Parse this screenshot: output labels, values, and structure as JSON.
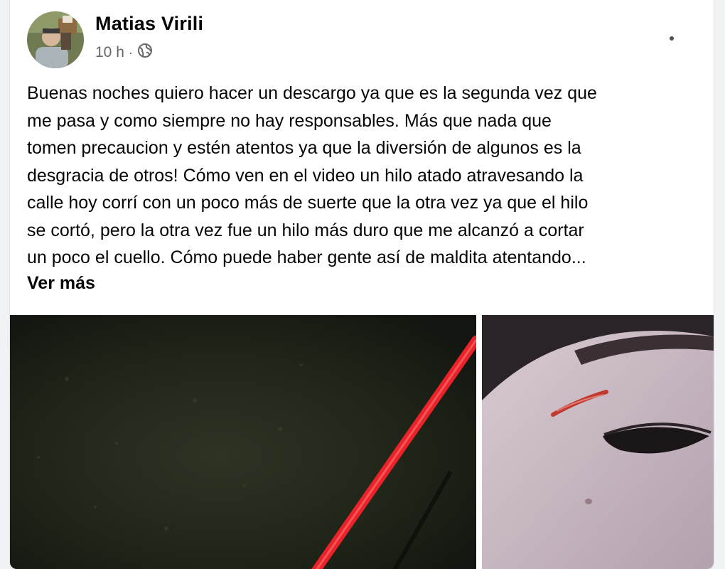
{
  "post": {
    "author": "Matias Virili",
    "time": "10 h",
    "separator": "·",
    "privacy_icon": "globe-icon",
    "more_icon": "ellipsis-icon",
    "body_lines": [
      "Buenas noches quiero hacer un descargo ya que es la segunda vez que",
      "me pasa y como siempre no hay responsables. Más que nada que",
      "tomen precaucion y estén atentos ya que la diversión de algunos es la",
      "desgracia de otros! Cómo ven en el video un hilo atado atravesando la",
      "calle hoy corrí con un poco más de suerte que la otra vez ya que el hilo",
      "se cortó, pero la otra vez fue un hilo más duro que me alcanzó a cortar",
      "un poco el cuello. Cómo puede haber gente así de maldita atentando..."
    ],
    "see_more": "Ver más"
  },
  "colors": {
    "background": "#f0f2f5",
    "card": "#ffffff",
    "primary_text": "#050505",
    "secondary_text": "#65676b",
    "thread": "#e8232a"
  }
}
